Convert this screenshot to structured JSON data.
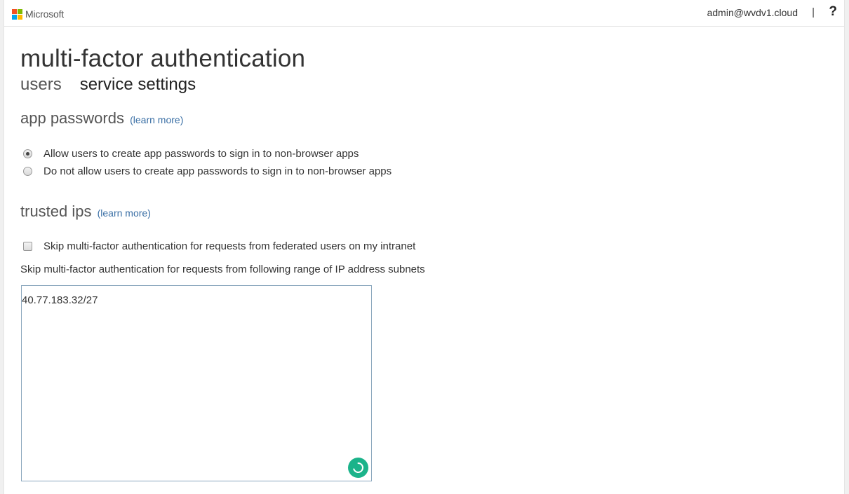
{
  "header": {
    "brand": "Microsoft",
    "account": "admin@wvdv1.cloud",
    "separator": "|",
    "help_icon": "?"
  },
  "page": {
    "title": "multi-factor authentication",
    "tabs": [
      {
        "label": "users",
        "active": false
      },
      {
        "label": "service settings",
        "active": true
      }
    ]
  },
  "app_passwords": {
    "title": "app passwords",
    "learn_more": "(learn more)",
    "options": [
      {
        "label": "Allow users to create app passwords to sign in to non-browser apps",
        "selected": true
      },
      {
        "label": "Do not allow users to create app passwords to sign in to non-browser apps",
        "selected": false
      }
    ]
  },
  "trusted_ips": {
    "title": "trusted ips",
    "learn_more": "(learn more)",
    "federated_checkbox": {
      "label": "Skip multi-factor authentication for requests from federated users on my intranet",
      "checked": false
    },
    "subnets_label": "Skip multi-factor authentication for requests from following range of IP address subnets",
    "subnets_value": "40.77.183.32/27"
  },
  "colors": {
    "ms_red": "#f25022",
    "ms_green": "#7fba00",
    "ms_blue": "#00a4ef",
    "ms_yellow": "#ffb900",
    "link": "#3a6fa5",
    "spinner": "#1bb38a"
  },
  "icons": [
    "microsoft-logo-icon",
    "help-icon",
    "loading-spinner-icon"
  ]
}
